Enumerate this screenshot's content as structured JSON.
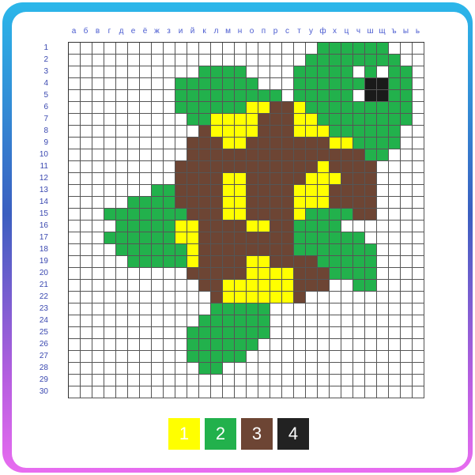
{
  "columns": [
    "а",
    "б",
    "в",
    "г",
    "д",
    "е",
    "ё",
    "ж",
    "з",
    "и",
    "й",
    "к",
    "л",
    "м",
    "н",
    "о",
    "п",
    "р",
    "с",
    "т",
    "у",
    "ф",
    "х",
    "ц",
    "ч",
    "ш",
    "щ",
    "ъ",
    "ы",
    "ь"
  ],
  "rows": [
    "1",
    "2",
    "3",
    "4",
    "5",
    "6",
    "7",
    "8",
    "9",
    "10",
    "11",
    "12",
    "13",
    "14",
    "15",
    "16",
    "17",
    "18",
    "19",
    "20",
    "21",
    "22",
    "23",
    "24",
    "25",
    "26",
    "27",
    "28",
    "29",
    "30"
  ],
  "colors": {
    "0": "#ffffff",
    "1": "#ffff00",
    "2": "#22b14c",
    "3": "#6d4534",
    "4": "#222222",
    "5": "#1a1a1a"
  },
  "grid": [
    "000000000000000000000222222000",
    "000000000000000000002222222200",
    "000000000002222000022222020220",
    "000000000222222200022222255220",
    "000000000222222222022222055220",
    "000000000222222113312222222220",
    "000000000022111133311222222220",
    "000000000003111133311122222200",
    "000000000033311333333311222200",
    "000000000033333333333333322000",
    "000000000333333333333133330000",
    "000000000333311333331113330000",
    "000000022333311333311133330000",
    "000002222333311333311133330000",
    "000222222233311333312222330000",
    "000022222113333113322220000000",
    "000222222113333333322222200000",
    "000022222213333333322222220000",
    "000002222213333113333222220000",
    "000000000033333111133322220000",
    "000000000003311111133300220000",
    "000000000000311111130000000000",
    "000000000000222220000000000000",
    "000000000002222220000000000000",
    "000000000022222220000000000000",
    "000000000022222200000000000000",
    "000000000022222000000000000000",
    "000000000002200000000000000000",
    "000000000000000000000000000000",
    "000000000000000000000000000000"
  ],
  "palette": [
    {
      "label": "1",
      "color": "#ffff00"
    },
    {
      "label": "2",
      "color": "#22b14c"
    },
    {
      "label": "3",
      "color": "#6d4534"
    },
    {
      "label": "4",
      "color": "#222222"
    }
  ]
}
